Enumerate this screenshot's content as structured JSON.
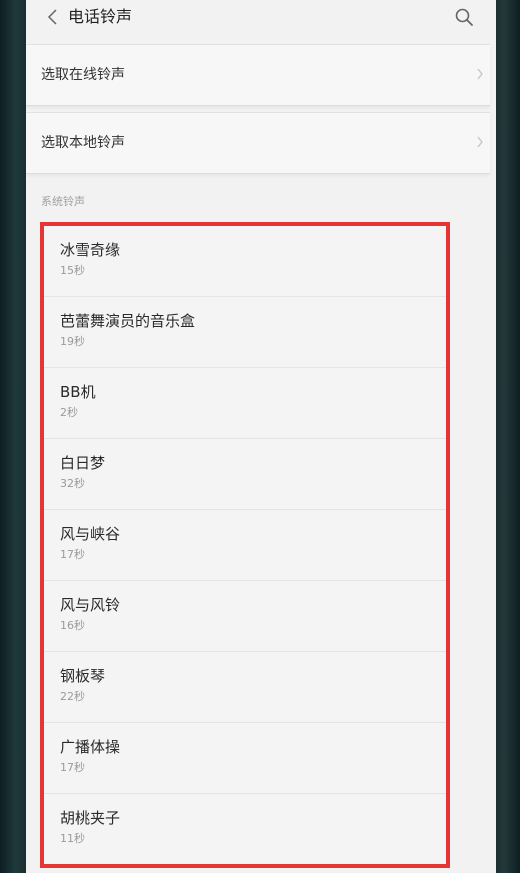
{
  "header": {
    "title": "电话铃声"
  },
  "options": {
    "online_label": "选取在线铃声",
    "local_label": "选取本地铃声"
  },
  "section": {
    "label": "系统铃声"
  },
  "ringtones": [
    {
      "name": "冰雪奇缘",
      "duration": "15秒"
    },
    {
      "name": "芭蕾舞演员的音乐盒",
      "duration": "19秒"
    },
    {
      "name": "BB机",
      "duration": "2秒"
    },
    {
      "name": "白日梦",
      "duration": "32秒"
    },
    {
      "name": "风与峡谷",
      "duration": "17秒"
    },
    {
      "name": "风与风铃",
      "duration": "16秒"
    },
    {
      "name": "钢板琴",
      "duration": "22秒"
    },
    {
      "name": "广播体操",
      "duration": "17秒"
    },
    {
      "name": "胡桃夹子",
      "duration": "11秒"
    }
  ],
  "colors": {
    "highlight_border": "#e53535"
  },
  "icons": {
    "back": "chevron-left-icon",
    "search": "search-icon",
    "arrow": "chevron-right-icon"
  }
}
